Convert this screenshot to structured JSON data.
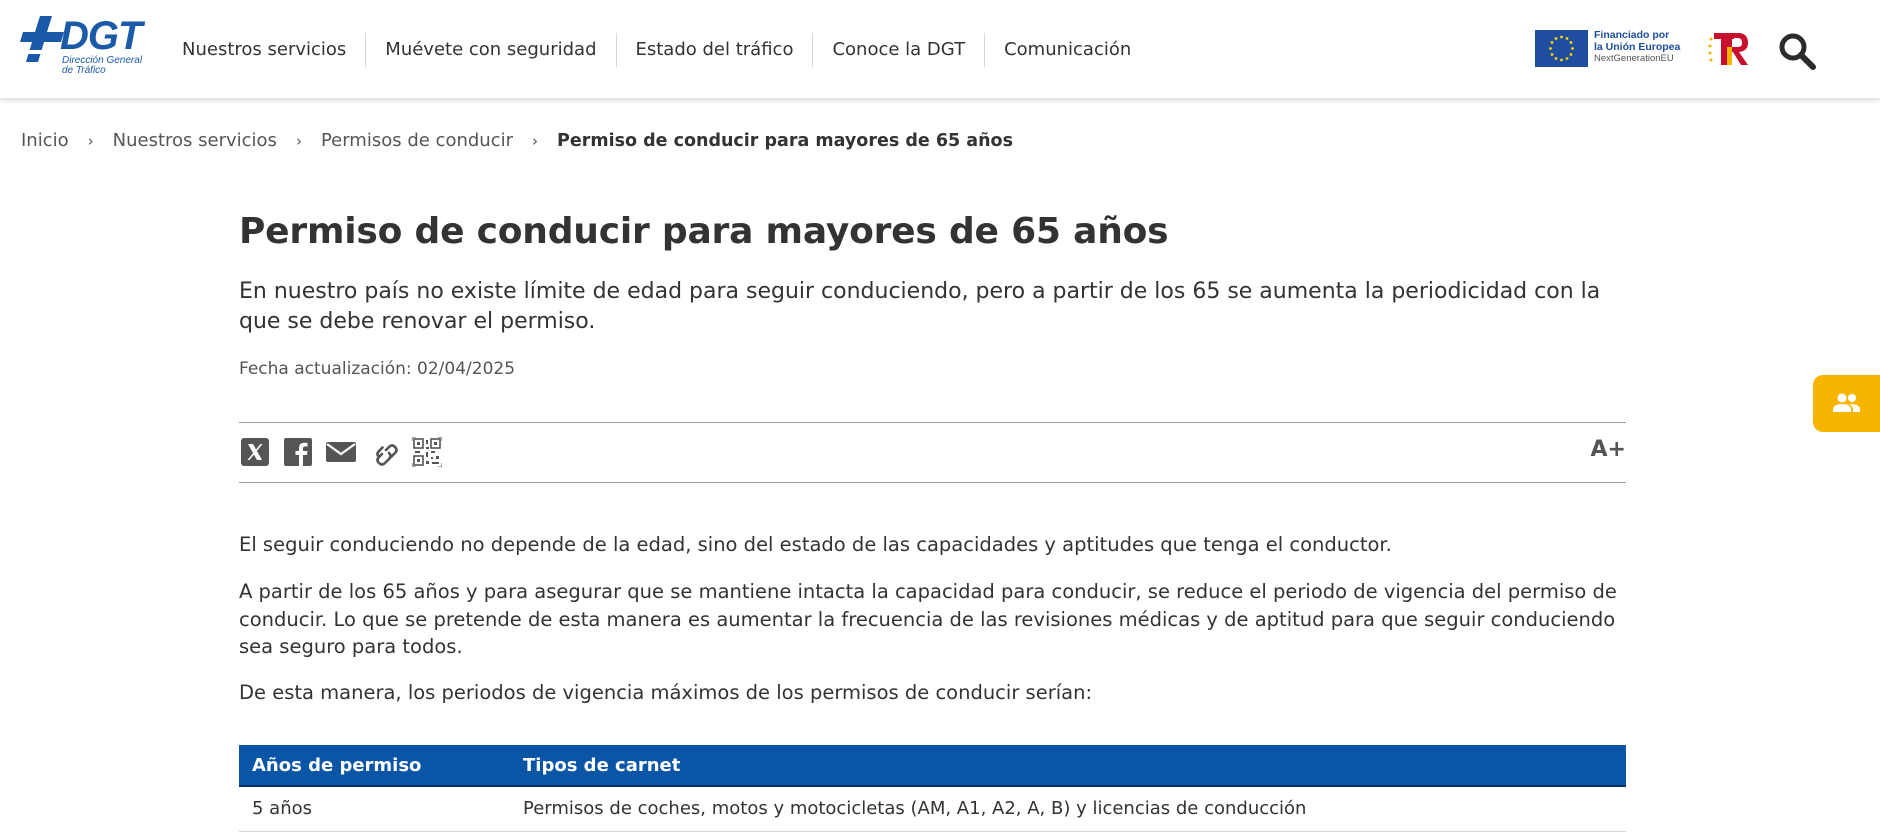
{
  "header": {
    "logo": {
      "brand": "DGT",
      "subtitle_line1": "Dirección General",
      "subtitle_line2": "de Tráfico"
    },
    "nav": [
      "Nuestros servicios",
      "Muévete con seguridad",
      "Estado del tráfico",
      "Conoce la DGT",
      "Comunicación"
    ],
    "eu_funding": {
      "line1": "Financiado por",
      "line2": "la Unión Europea",
      "line3": "NextGenerationEU"
    },
    "icons": {
      "search": "search-icon",
      "tr_logo": "tr-logo-icon",
      "eu_flag": "eu-flag-icon"
    }
  },
  "breadcrumb": {
    "items": [
      "Inicio",
      "Nuestros servicios",
      "Permisos de conducir"
    ],
    "separator": "›",
    "current": "Permiso de conducir para mayores de 65 años"
  },
  "article": {
    "title": "Permiso de conducir para mayores de 65 años",
    "lead": "En nuestro país no existe límite de edad para seguir conduciendo, pero a partir de los 65 se aumenta la periodicidad con la que se debe renovar el permiso.",
    "date": "Fecha actualización: 02/04/2025",
    "share_icons": [
      "x-icon",
      "facebook-icon",
      "email-icon",
      "link-icon",
      "qr-code-icon"
    ],
    "font_size_label": "A+",
    "paragraphs": [
      "El seguir conduciendo no depende de la edad, sino del estado de las capacidades y aptitudes que tenga el conductor.",
      "A partir de los 65 años y para asegurar que se mantiene intacta la capacidad para conducir, se reduce el periodo de vigencia del permiso de conducir. Lo que se pretende de esta manera es aumentar la frecuencia de las revisiones médicas y de aptitud para que seguir conduciendo sea seguro para todos.",
      "De esta manera, los periodos de vigencia máximos de los permisos de conducir serían:"
    ],
    "table": {
      "headers": [
        "Años de permiso",
        "Tipos de carnet"
      ],
      "rows": [
        [
          "5 años",
          "Permisos de coches, motos y motocicletas (AM, A1, A2, A, B) y licencias de conducción"
        ]
      ]
    }
  },
  "side_tab": {
    "icon": "people-icon"
  },
  "colors": {
    "primary_blue": "#0a55a6",
    "logo_blue": "#1a5aa8",
    "accent_yellow": "#f7b500",
    "text": "#333333"
  }
}
